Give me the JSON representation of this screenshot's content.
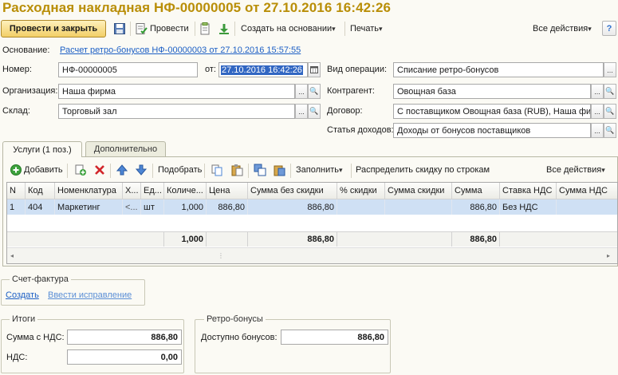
{
  "title": "Расходная накладная НФ-00000005 от 27.10.2016 16:42:26",
  "toolbar": {
    "post_and_close": "Провести и закрыть",
    "post": "Провести",
    "create_based_on": "Создать на основании",
    "print": "Печать",
    "all_actions": "Все действия"
  },
  "header": {
    "basis_label": "Основание:",
    "basis_link": "Расчет ретро-бонусов НФ-00000003 от 27.10.2016 15:57:55",
    "number_label": "Номер:",
    "number_value": "НФ-00000005",
    "date_label": "от:",
    "date_value": "27.10.2016 16:42:26",
    "org_label": "Организация:",
    "org_value": "Наша фирма",
    "warehouse_label": "Склад:",
    "warehouse_value": "Торговый зал",
    "optype_label": "Вид операции:",
    "optype_value": "Списание ретро-бонусов",
    "counterparty_label": "Контрагент:",
    "counterparty_value": "Овощная база",
    "contract_label": "Договор:",
    "contract_value": "С поставщиком Овощная база (RUB), Наша фир",
    "income_label": "Статья доходов:",
    "income_value": "Доходы от бонусов поставщиков"
  },
  "tabs": [
    {
      "label": "Услуги (1 поз.)",
      "active": true
    },
    {
      "label": "Дополнительно",
      "active": false
    }
  ],
  "table_toolbar": {
    "add": "Добавить",
    "pick": "Подобрать",
    "fill": "Заполнить",
    "distribute": "Распределить скидку по строкам",
    "all_actions": "Все действия"
  },
  "table": {
    "columns": [
      "N",
      "Код",
      "Номенклатура",
      "Х...",
      "Ед...",
      "Количе...",
      "Цена",
      "Сумма без скидки",
      "% скидки",
      "Сумма скидки",
      "Сумма",
      "Ставка НДС",
      "Сумма НДС"
    ],
    "rows": [
      {
        "n": "1",
        "code": "404",
        "item": "Маркетинг",
        "char": "<...",
        "unit": "шт",
        "qty": "1,000",
        "price": "886,80",
        "sum_no_disc": "886,80",
        "disc_pct": "",
        "disc_sum": "",
        "sum": "886,80",
        "vat_rate": "Без НДС",
        "vat_sum": ""
      }
    ],
    "totals": {
      "qty": "1,000",
      "sum_no_disc": "886,80",
      "sum": "886,80"
    }
  },
  "invoice": {
    "title": "Счет-фактура",
    "create": "Создать",
    "correction": "Ввести исправление"
  },
  "totals": {
    "title": "Итоги",
    "sum_vat_label": "Сумма с НДС:",
    "sum_vat_value": "886,80",
    "vat_label": "НДС:",
    "vat_value": "0,00"
  },
  "retro": {
    "title": "Ретро-бонусы",
    "available_label": "Доступно бонусов:",
    "available_value": "886,80"
  },
  "colors": {
    "title": "#b98e07",
    "accent_button": "#f2cf68",
    "link": "#1c5fc5",
    "selection": "#cfe0f4"
  }
}
